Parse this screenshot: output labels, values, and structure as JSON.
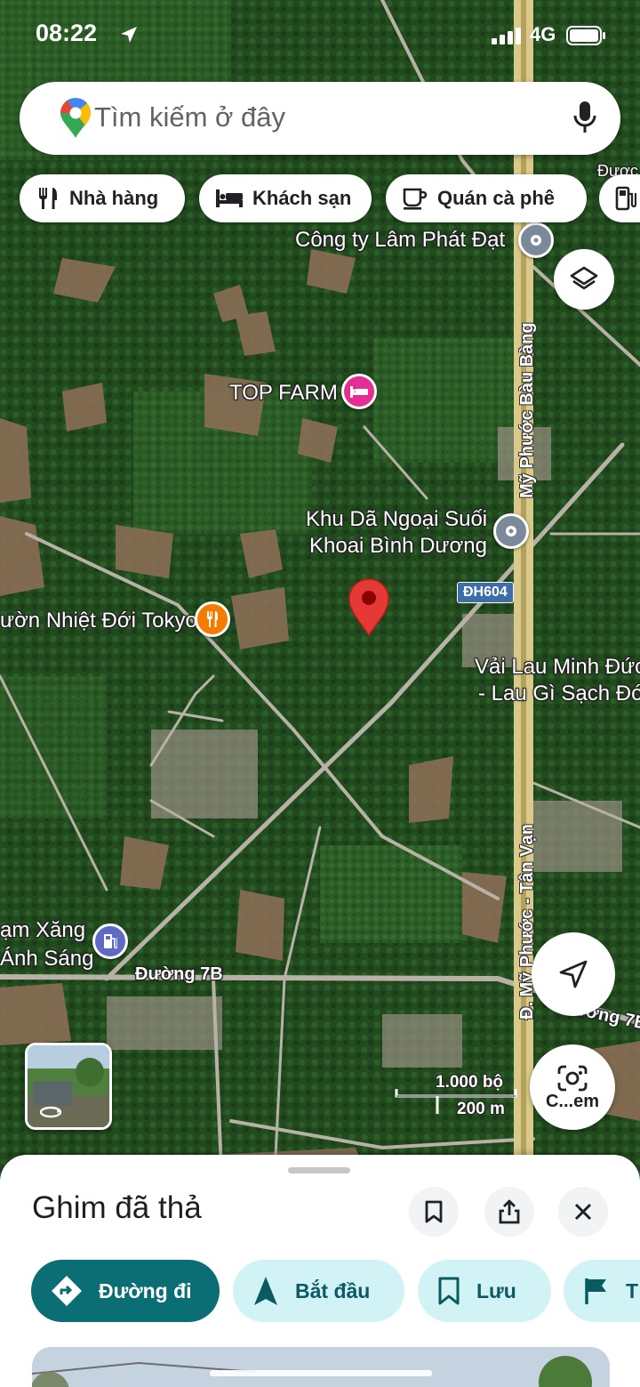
{
  "status_bar": {
    "time": "08:22",
    "network": "4G"
  },
  "search": {
    "placeholder": "Tìm kiếm ở đây"
  },
  "chips": [
    {
      "label": "Nhà hàng",
      "icon": "fork-knife-icon"
    },
    {
      "label": "Khách sạn",
      "icon": "bed-icon"
    },
    {
      "label": "Quán cà phê",
      "icon": "coffee-cup-icon"
    },
    {
      "label": "",
      "icon": "gas-station-icon"
    }
  ],
  "map": {
    "places": {
      "lam_phat_dat": "Công ty Lâm Phát Đạt",
      "top_farm": "TOP FARM",
      "khu_da_ngoai_line1": "Khu Dã Ngoại Suối",
      "khu_da_ngoai_line2": "Khoai Bình Dương",
      "tokyo": "ườn Nhiệt Đới Tokyo",
      "vai_lau_line1": "Vải Lau Minh Đức",
      "vai_lau_line2": "- Lau Gì Sạch Đó",
      "tram_xang_line1": "ạm Xăng",
      "tram_xang_line2": "Ánh Sáng",
      "top_right_partial": "Được"
    },
    "roads": {
      "my_phuoc_bau_bang": "Mỹ Phước Bàu Bàng",
      "my_phuoc_tan_van": "Đ. Mỹ Phước - Tân Vạn",
      "duong_7b": "Đường 7B",
      "duong_7b_right": "Đường 7B",
      "dh604": "ĐH604"
    },
    "scale": {
      "imperial": "1.000 bộ",
      "metric": "200 m"
    },
    "camera_label": "C...em",
    "colors": {
      "pin": "#e53935",
      "hotel_poi": "#e52d94",
      "restaurant_poi": "#f57c00",
      "gas_poi": "#5e6bc4",
      "generic_poi": "#7b8a99"
    }
  },
  "sheet": {
    "title": "Ghim đã thả",
    "actions": [
      {
        "label": "Đường đi",
        "icon": "directions-icon"
      },
      {
        "label": "Bắt đầu",
        "icon": "navigation-arrow-icon"
      },
      {
        "label": "Lưu",
        "icon": "bookmark-icon"
      },
      {
        "label": "T",
        "icon": "flag-icon"
      }
    ],
    "accent": "#0b6e75"
  }
}
